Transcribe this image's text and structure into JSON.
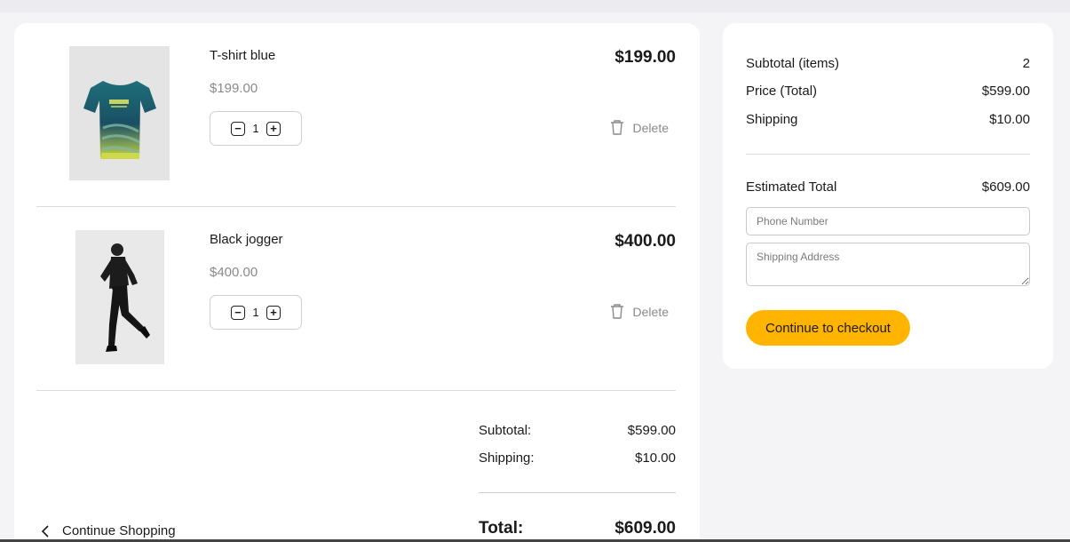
{
  "cart": {
    "items": [
      {
        "name": "T-shirt blue",
        "unit_price": "$199.00",
        "quantity": "1",
        "line_total": "$199.00",
        "delete_label": "Delete"
      },
      {
        "name": "Black jogger",
        "unit_price": "$400.00",
        "quantity": "1",
        "line_total": "$400.00",
        "delete_label": "Delete"
      }
    ],
    "summary": {
      "subtotal_label": "Subtotal:",
      "subtotal_value": "$599.00",
      "shipping_label": "Shipping:",
      "shipping_value": "$10.00",
      "total_label": "Total:",
      "total_value": "$609.00"
    },
    "continue_shopping_label": "Continue Shopping"
  },
  "order_summary": {
    "subtotal_items_label": "Subtotal (items)",
    "subtotal_items_value": "2",
    "price_total_label": "Price (Total)",
    "price_total_value": "$599.00",
    "shipping_label": "Shipping",
    "shipping_value": "$10.00",
    "estimated_total_label": "Estimated Total",
    "estimated_total_value": "$609.00",
    "phone_placeholder": "Phone Number",
    "address_placeholder": "Shipping Address",
    "checkout_label": "Continue to checkout"
  },
  "colors": {
    "accent": "#ffb400",
    "muted_text": "#8a8a8a",
    "background": "#f4f4f6"
  },
  "icons": [
    "tshirt-product-image",
    "jogger-product-image",
    "minus-icon",
    "plus-icon",
    "trash-icon",
    "chevron-left-icon"
  ]
}
